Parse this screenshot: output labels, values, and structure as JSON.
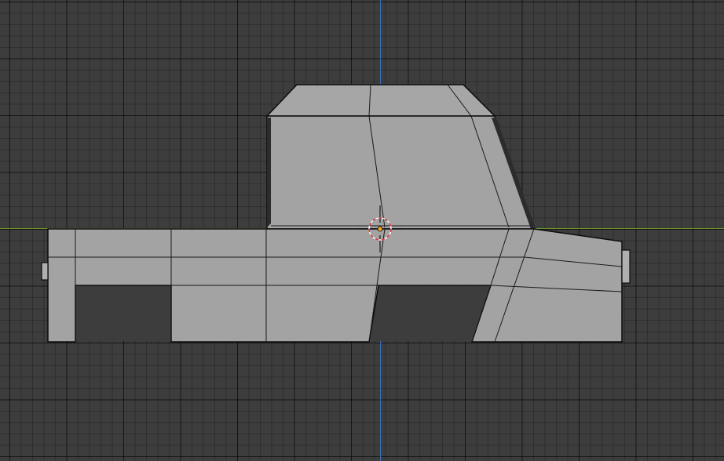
{
  "app": {
    "view": "front-orthographic-viewport",
    "colors": {
      "background": "#3d3d3d",
      "x_axis": "#6a9a2a",
      "z_axis": "#3b6fb4",
      "mesh_face": "#a3a3a3",
      "mesh_edge": "#1a1a1a",
      "mesh_outline": "#0c0c0c",
      "cursor_ring_a": "#d53b3b",
      "cursor_ring_b": "#f2f2f2",
      "origin_point": "#f5a623"
    }
  },
  "scene": {
    "object": "vehicle-mesh",
    "mode": "wireframe-overlay",
    "cursor": "3d-cursor",
    "origin": "object-origin"
  }
}
